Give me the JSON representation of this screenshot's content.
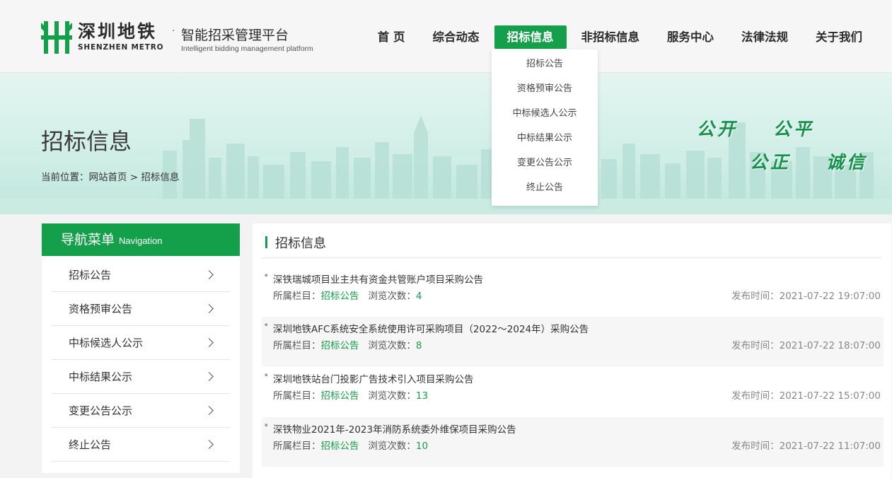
{
  "brand": {
    "name_cn": "深圳地铁",
    "name_en": "SHENZHEN METRO",
    "separator": "·",
    "platform_cn": "智能招采管理平台",
    "platform_en": "Intelligent bidding management platform",
    "color": "#14a04a"
  },
  "nav": {
    "items": [
      "首 页",
      "综合动态",
      "招标信息",
      "非招标信息",
      "服务中心",
      "法律法规",
      "关于我们"
    ],
    "active": "招标信息"
  },
  "dropdown": {
    "items": [
      "招标公告",
      "资格预审公告",
      "中标候选人公示",
      "中标结果公示",
      "变更公告公示",
      "终止公告"
    ]
  },
  "banner": {
    "title": "招标信息",
    "breadcrumb": "当前位置：网站首页 > 招标信息",
    "slogans": [
      "公开",
      "公平",
      "公正",
      "诚信"
    ]
  },
  "sidebar": {
    "title_cn": "导航菜单",
    "title_en": "Navigation",
    "items": [
      "招标公告",
      "资格预审公告",
      "中标候选人公示",
      "中标结果公示",
      "变更公告公示",
      "终止公告"
    ]
  },
  "main": {
    "title": "招标信息",
    "category_label": "所属栏目：",
    "views_label": "浏览次数：",
    "date_label": "发布时间：",
    "rows": [
      {
        "title": "深铁瑞城项目业主共有资金共管账户项目采购公告",
        "category": "招标公告",
        "views": "4",
        "date": "2021-07-22 19:07:00"
      },
      {
        "title": "深圳地铁AFC系统安全系统使用许可采购项目（2022～2024年）采购公告",
        "category": "招标公告",
        "views": "8",
        "date": "2021-07-22 18:07:00"
      },
      {
        "title": "深圳地铁站台门投影广告技术引入项目采购公告",
        "category": "招标公告",
        "views": "13",
        "date": "2021-07-22 15:07:00"
      },
      {
        "title": "深铁物业2021年-2023年消防系统委外维保项目采购公告",
        "category": "招标公告",
        "views": "10",
        "date": "2021-07-22 11:07:00"
      }
    ]
  }
}
